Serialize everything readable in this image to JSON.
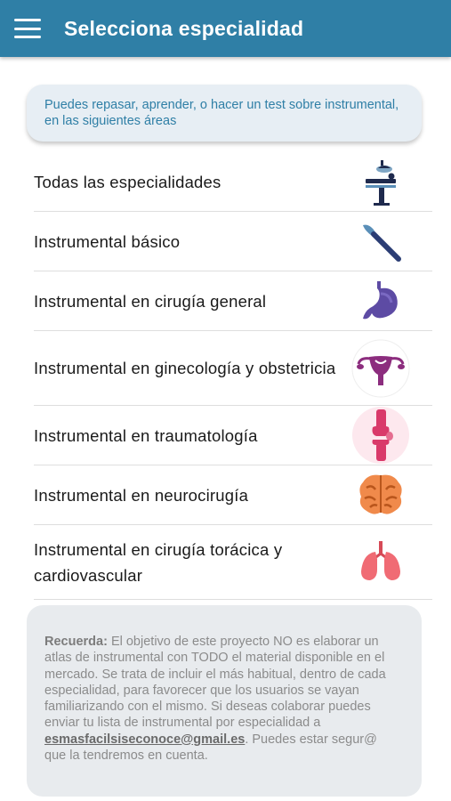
{
  "appbar": {
    "title": "Selecciona especialidad",
    "menu_icon": "hamburger-menu-icon",
    "color": "#2f7fa6"
  },
  "info": {
    "text": "Puedes repasar, aprender, o hacer un test sobre instrumental, en las siguientes áreas"
  },
  "specialties": [
    {
      "label": "Todas las especialidades",
      "icon": "operating-table-icon"
    },
    {
      "label": "Instrumental básico",
      "icon": "scalpel-icon"
    },
    {
      "label": "Instrumental en cirugía general",
      "icon": "stomach-icon"
    },
    {
      "label": "Instrumental en ginecología y obstetricia",
      "icon": "uterus-icon"
    },
    {
      "label": "Instrumental en traumatología",
      "icon": "knee-joint-icon"
    },
    {
      "label": "Instrumental en neurocirugía",
      "icon": "brain-icon"
    },
    {
      "label": "Instrumental en cirugía torácica y cardiovascular",
      "icon": "lungs-icon"
    }
  ],
  "note": {
    "heading": "Recuerda:",
    "body1": " El objetivo de este proyecto NO es elaborar un atlas de instrumental con TODO el material disponible en el mercado. Se trata de incluir el más habitual, dentro de cada especialidad, para favorecer que los usuarios se vayan familiarizando con el mismo. Si deseas colaborar puedes enviar tu lista de instrumental por especialidad a ",
    "email": "esmasfacilsiseconoce@gmail.es",
    "body2": ". Puedes estar segur@ que la tendremos en cuenta."
  }
}
